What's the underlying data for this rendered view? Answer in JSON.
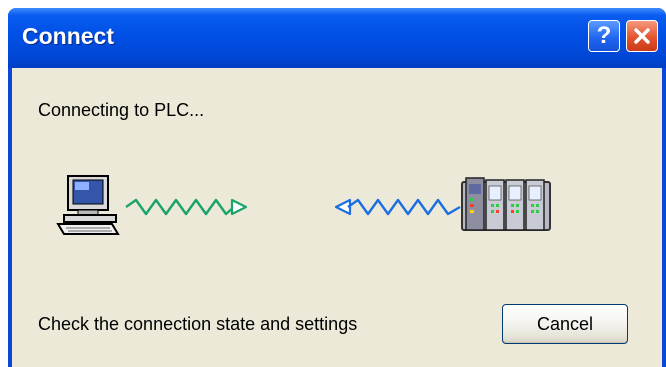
{
  "window": {
    "title": "Connect",
    "help_label": "?",
    "close_icon": "close-icon"
  },
  "dialog": {
    "status_text": "Connecting to PLC...",
    "message": "Check the connection state and settings",
    "cancel_label": "Cancel"
  },
  "icons": {
    "computer": "computer-icon",
    "plc": "plc-icon",
    "signal_out": "signal-wave-right-icon",
    "signal_in": "signal-wave-left-icon"
  },
  "colors": {
    "titlebar": "#0050e6",
    "dialog_bg": "#ece9d8",
    "close_button": "#e3542f",
    "wave": "#1aa36a"
  }
}
